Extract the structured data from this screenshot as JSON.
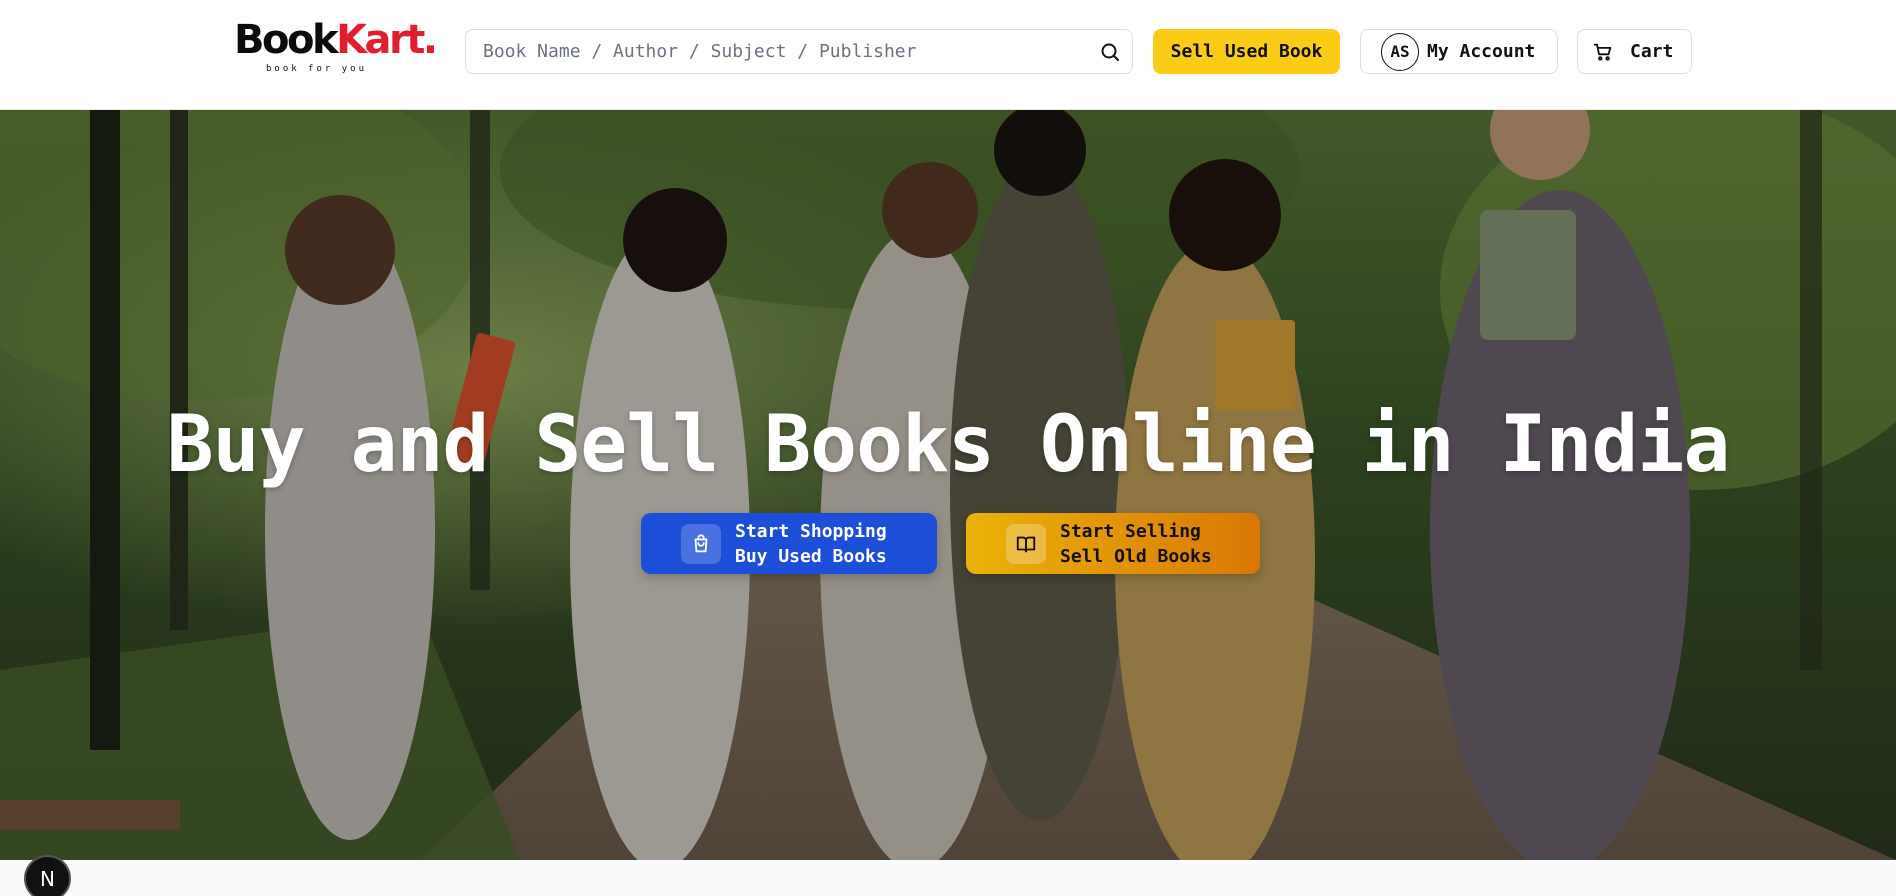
{
  "brand": {
    "name_dark": "Book",
    "name_red": "Kart.",
    "tagline": "book for you"
  },
  "search": {
    "placeholder": "Book Name / Author / Subject / Publisher",
    "value": "",
    "icon": "search-icon"
  },
  "nav": {
    "sell_label": "Sell Used Book",
    "account_initials": "AS",
    "account_label": "My Account",
    "cart_label": "Cart"
  },
  "hero": {
    "title": "Buy and Sell Books Online in India",
    "shop_cta": {
      "line1": "Start Shopping",
      "line2": "Buy Used Books",
      "icon": "shopping-bag-icon"
    },
    "sell_cta": {
      "line1": "Start Selling",
      "line2": "Sell Old Books",
      "icon": "book-open-icon"
    }
  },
  "dev_badge": {
    "label": "N"
  },
  "colors": {
    "accent_yellow": "#facc15",
    "accent_blue": "#1d4ed8",
    "brand_red": "#e11d2e"
  }
}
